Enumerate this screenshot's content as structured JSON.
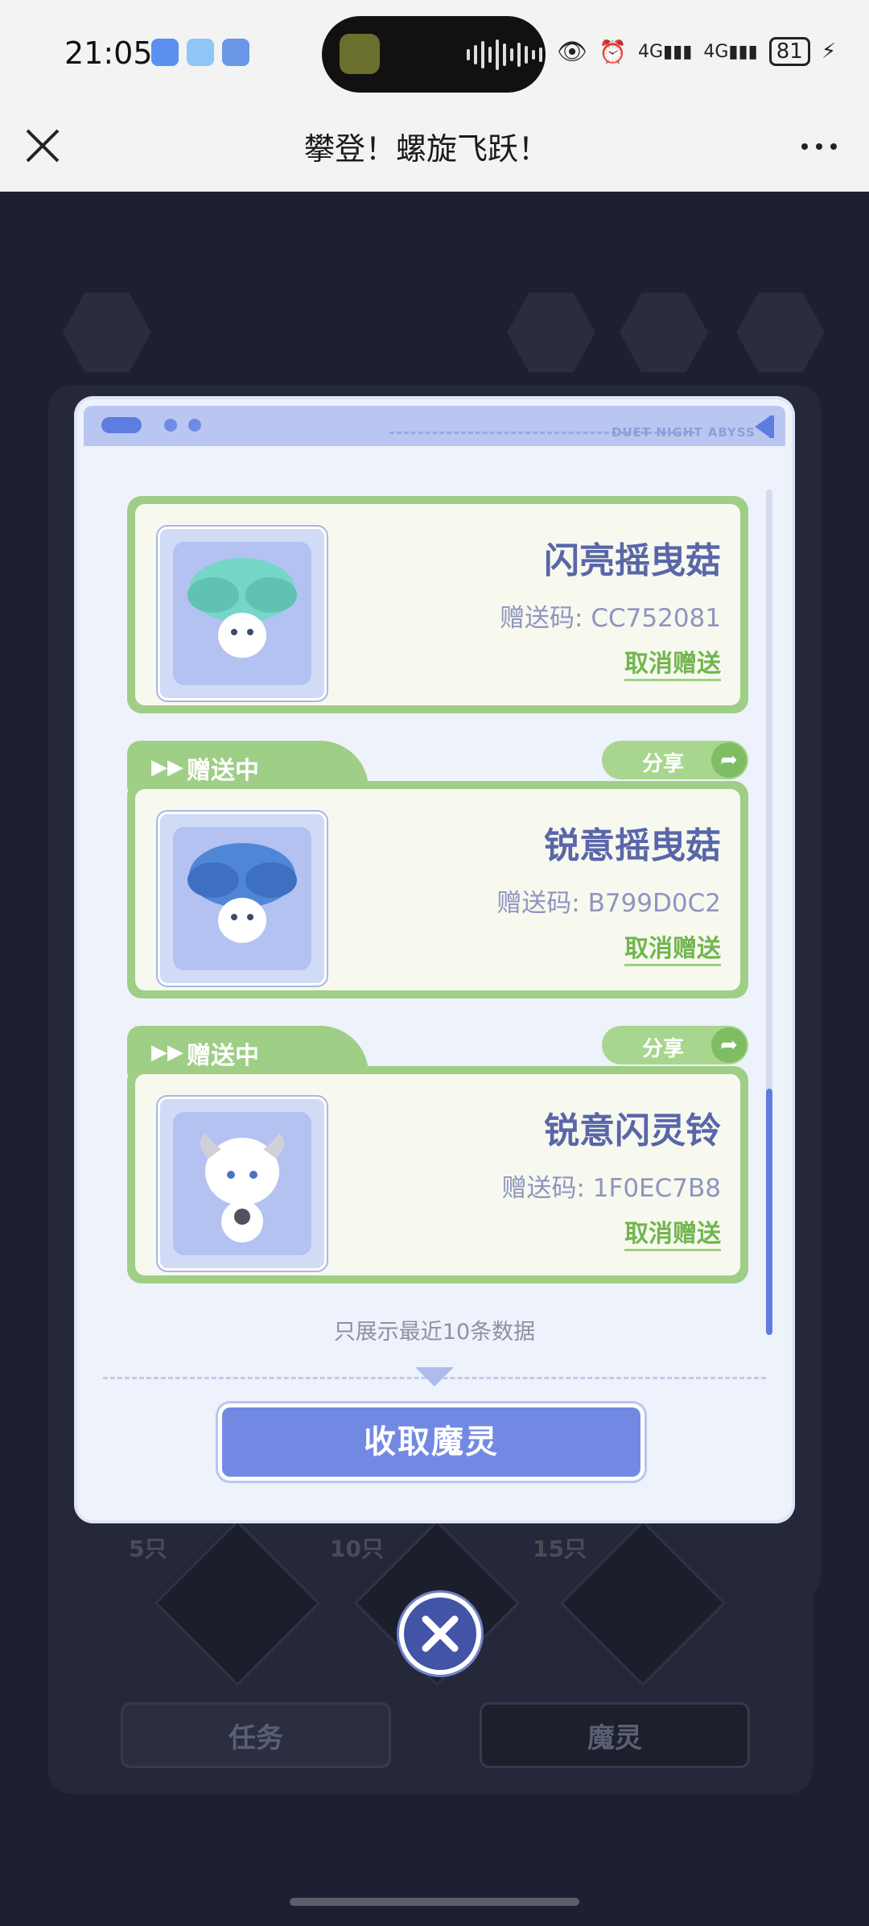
{
  "status_bar": {
    "time": "21:05",
    "network_1": "4G",
    "network_2": "4G",
    "battery": "81"
  },
  "header": {
    "title": "攀登！螺旋飞跃！"
  },
  "modal": {
    "header_watermark": "DUET NIGHT ABYSS",
    "items": [
      {
        "status": "",
        "share_label": "",
        "name": "闪亮摇曳菇",
        "code_label": "赠送码: CC752081",
        "cancel_label": "取消赠送"
      },
      {
        "status": "赠送中",
        "share_label": "分享",
        "name": "锐意摇曳菇",
        "code_label": "赠送码: B799D0C2",
        "cancel_label": "取消赠送"
      },
      {
        "status": "赠送中",
        "share_label": "分享",
        "name": "锐意闪灵铃",
        "code_label": "赠送码: 1F0EC7B8",
        "cancel_label": "取消赠送"
      }
    ],
    "note": "只展示最近10条数据",
    "collect_button": "收取魔灵"
  },
  "background": {
    "badges": [
      "5只",
      "10只",
      "15只"
    ],
    "tab_task": "任务",
    "tab_spirit": "魔灵"
  }
}
